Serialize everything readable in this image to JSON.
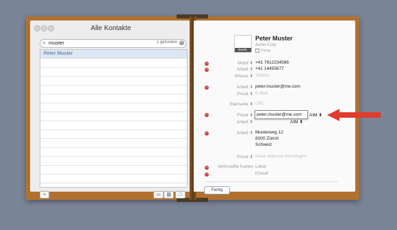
{
  "window": {
    "title": "Alle Kontakte"
  },
  "search": {
    "value": "muster",
    "count": "1 gefunden"
  },
  "list": {
    "rows": [
      "Peter Muster",
      "",
      "",
      "",
      "",
      "",
      "",
      "",
      "",
      "",
      "",
      "",
      "",
      "",
      "",
      ""
    ]
  },
  "bottom": {
    "add_label": "+"
  },
  "card": {
    "photo_label": "Bearb.",
    "name": "Peter Muster",
    "company": "Acme Corp.",
    "firm_label": "Firma",
    "phones": [
      {
        "label": "Mobil ⬍",
        "value": "+41 7612234566"
      },
      {
        "label": "Arbeit ⬍",
        "value": "+41 14455677"
      },
      {
        "label": "iPhone ⬍",
        "value": "Telefon"
      }
    ],
    "emails": [
      {
        "label": "Arbeit ⬍",
        "value": "peter.muster@me.com"
      },
      {
        "label": "Privat ⬍",
        "value": "E-Mail"
      }
    ],
    "homepage": {
      "label": "Startseite ⬍",
      "value": "URL"
    },
    "im": [
      {
        "label": "Privat ⬍",
        "value": "peter.muster@me.com",
        "service": "AIM ⬍"
      },
      {
        "label": "Arbeit ⬍",
        "value": "",
        "service": "AIM ⬍"
      }
    ],
    "address": {
      "label": "Arbeit ⬍",
      "lines": [
        "Musterweg 12",
        "8000 Zürich",
        "Schweiz"
      ]
    },
    "address_new": {
      "label": "Privat ⬍",
      "value": "Neue Adresse hinzufügen"
    },
    "linked": {
      "label": "Verknüpfte Karten",
      "values": [
        "Lokal",
        "iCloud"
      ]
    },
    "done_label": "Fertig"
  },
  "colors": {
    "background": "#7a8497",
    "book": "#b0712f",
    "delete": "#d53d36",
    "arrow": "#e03b2c"
  }
}
